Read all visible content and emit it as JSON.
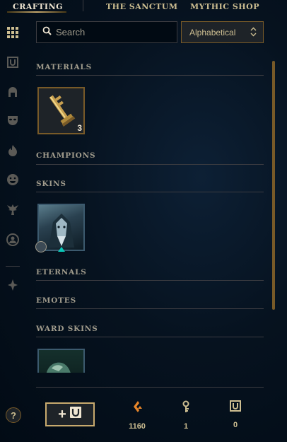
{
  "nav": {
    "tabs": [
      {
        "label": "CRAFTING",
        "active": true
      },
      {
        "label": "THE SANCTUM",
        "active": false
      },
      {
        "label": "MYTHIC SHOP",
        "active": false
      }
    ]
  },
  "search": {
    "placeholder": "Search"
  },
  "sort": {
    "selected": "Alphabetical"
  },
  "sections": {
    "materials": {
      "title": "MATERIALS",
      "items": [
        {
          "icon": "hextech-key-fragment-icon",
          "count": "3"
        }
      ]
    },
    "champions": {
      "title": "CHAMPIONS"
    },
    "skins": {
      "title": "SKINS",
      "items": [
        {
          "icon": "skin-shard-icon"
        }
      ]
    },
    "eternals": {
      "title": "ETERNALS"
    },
    "emotes": {
      "title": "EMOTES"
    },
    "ward_skins": {
      "title": "WARD SKINS",
      "items": [
        {
          "icon": "ward-skin-icon"
        }
      ]
    }
  },
  "rail": [
    "all-items-icon",
    "chest-icon",
    "helmet-icon",
    "mask-icon",
    "flame-icon",
    "smiley-icon",
    "ward-icon",
    "profile-icon",
    "eternals-icon"
  ],
  "footer": {
    "help": "?",
    "add_label": "+",
    "currencies": [
      {
        "icon": "orange-essence-icon",
        "value": "1160"
      },
      {
        "icon": "key-icon",
        "value": "1"
      },
      {
        "icon": "chest-icon",
        "value": "0"
      }
    ]
  },
  "colors": {
    "gold": "#c8aa6e",
    "text": "#a09b8c",
    "orange": "#e7862a"
  }
}
